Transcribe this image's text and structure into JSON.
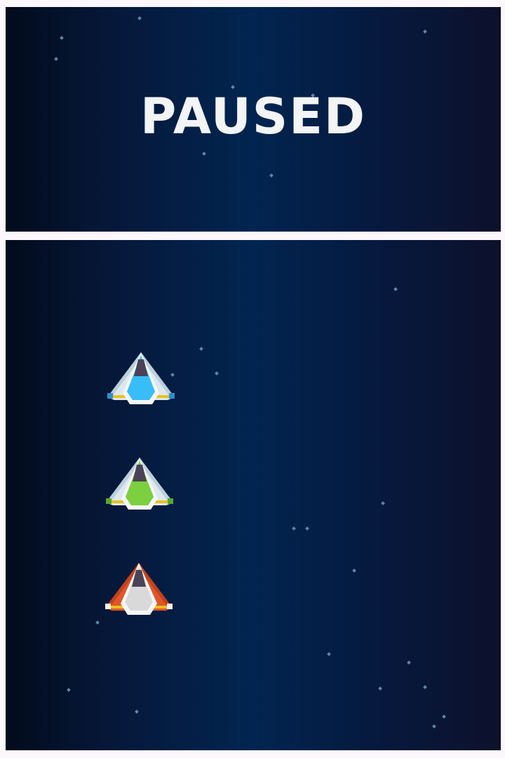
{
  "screen": {
    "title": "PAUSED",
    "background_colors": [
      "#020b1c",
      "#012550",
      "#0d112b"
    ],
    "star_color": "#5f88a8"
  },
  "ships": [
    {
      "name": "blue-ship",
      "accent": "#38bdf8",
      "wing": "#dde8ee",
      "tip": "#2a8fd0"
    },
    {
      "name": "green-ship",
      "accent": "#7ccf3f",
      "wing": "#dde8ee",
      "tip": "#5aa62e"
    },
    {
      "name": "red-ship",
      "accent": "#d9d9d9",
      "wing": "#e0562a",
      "tip": "#f2f2f2"
    }
  ]
}
